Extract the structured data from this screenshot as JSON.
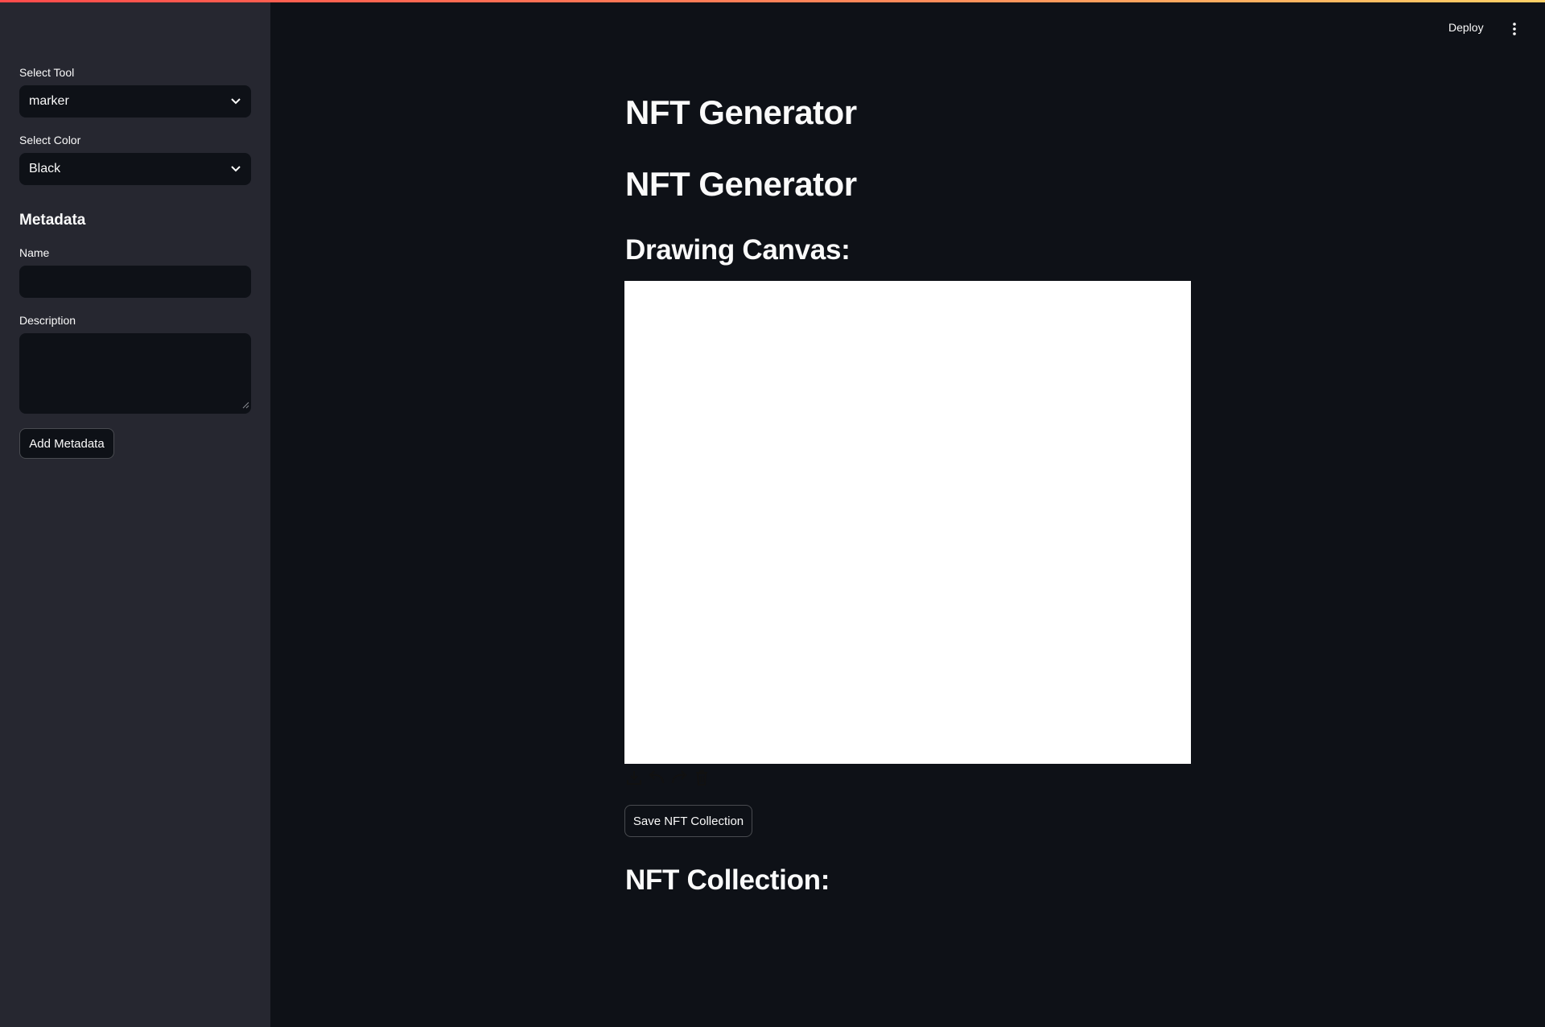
{
  "header": {
    "deploy_label": "Deploy",
    "menu_icon": "kebab-menu-icon",
    "accent_gradient": [
      "#ff4b4b",
      "#ffd166"
    ]
  },
  "sidebar": {
    "tool": {
      "label": "Select Tool",
      "value": "marker"
    },
    "color": {
      "label": "Select Color",
      "value": "Black"
    },
    "metadata_heading": "Metadata",
    "name": {
      "label": "Name",
      "value": "",
      "placeholder": ""
    },
    "description": {
      "label": "Description",
      "value": "",
      "placeholder": ""
    },
    "add_button": "Add Metadata"
  },
  "main": {
    "title_1": "NFT Generator",
    "title_2": "NFT Generator",
    "canvas_heading": "Drawing Canvas:",
    "canvas_background": "#ffffff",
    "canvas_tools": [
      "download-icon",
      "undo-icon",
      "redo-icon",
      "trash-icon"
    ],
    "save_button": "Save NFT Collection",
    "collection_heading": "NFT Collection:"
  },
  "colors": {
    "app_bg": "#0e1117",
    "sidebar_bg": "#262730",
    "text": "#fafafa"
  }
}
